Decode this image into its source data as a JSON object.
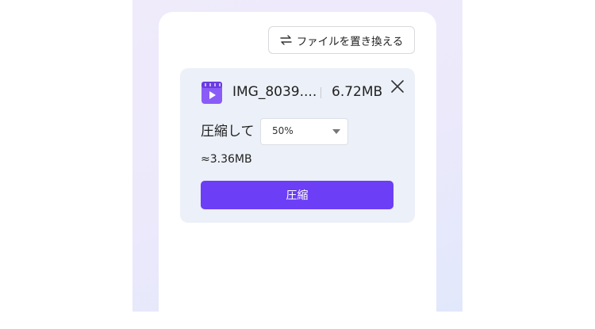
{
  "header": {
    "replace_file_label": "ファイルを置き換える"
  },
  "file": {
    "name": "IMG_8039....",
    "size": "6.72MB",
    "icon": "video-file-icon"
  },
  "compression": {
    "label": "圧縮して",
    "selected_option": "50%",
    "estimated_size": "≈3.36MB",
    "button_label": "圧縮"
  },
  "colors": {
    "accent": "#6c3ef5",
    "card_background": "#ecf0f8",
    "page_gradient_start": "#efebfb",
    "page_gradient_end": "#e2e8fb"
  }
}
